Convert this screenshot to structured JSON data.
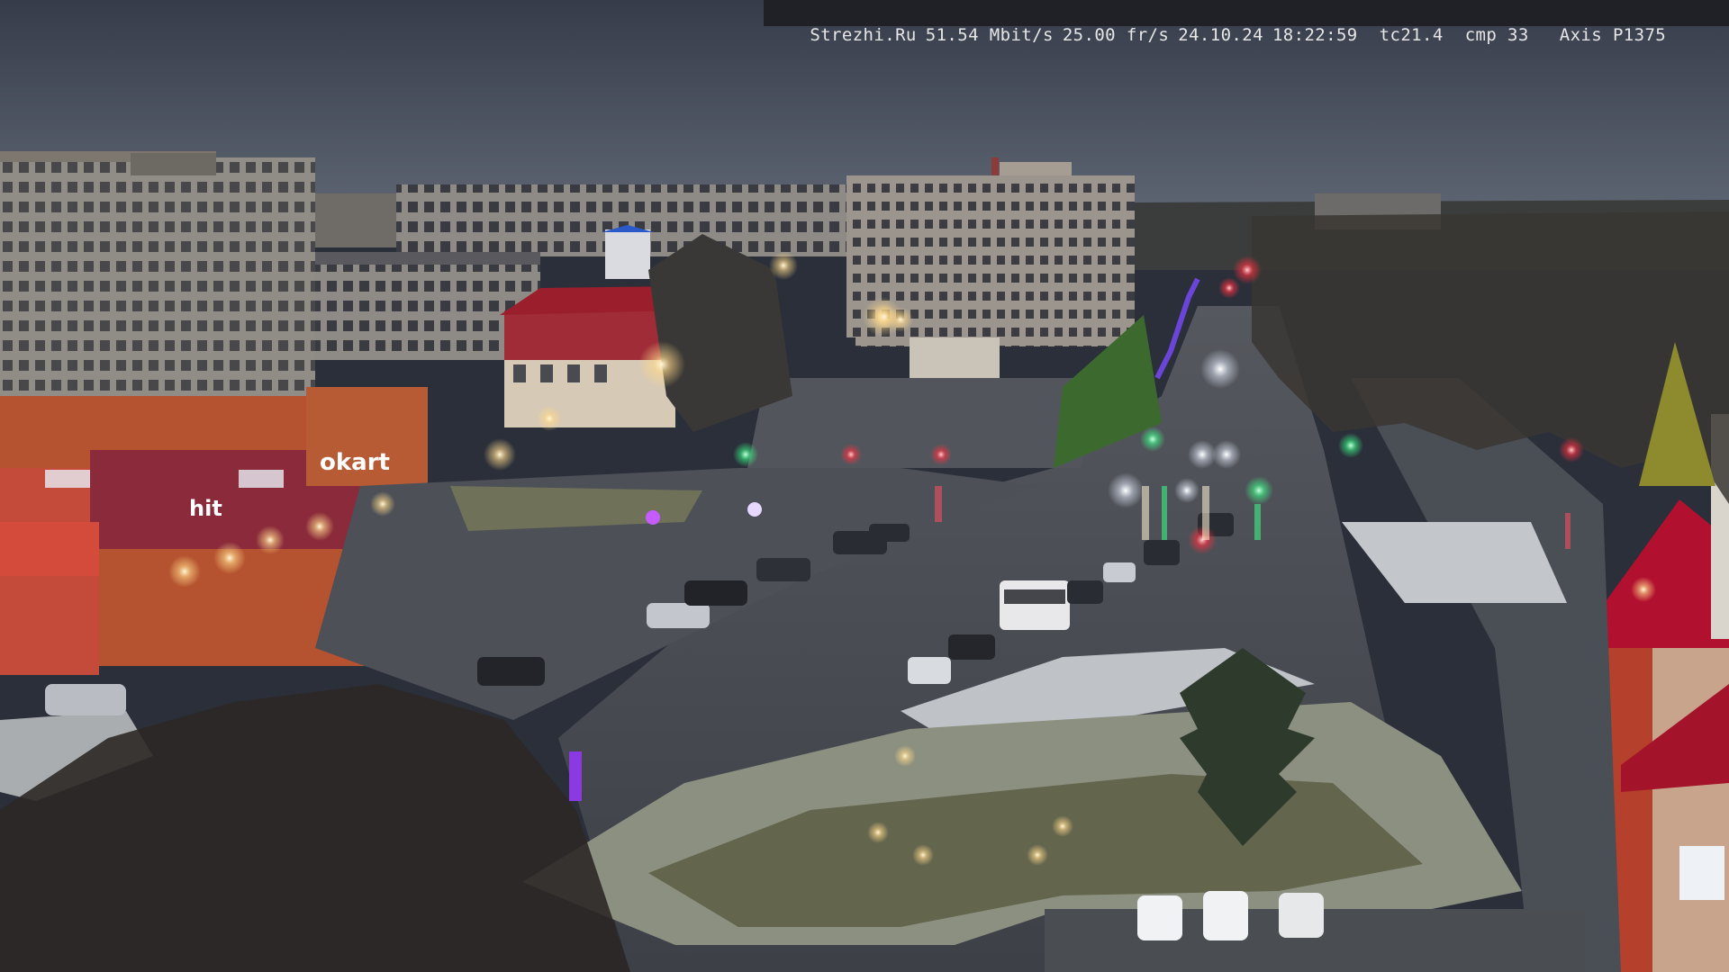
{
  "overlay": {
    "site": "Strezhi.Ru",
    "bitrate": "51.54 Mbit/s",
    "framerate": "25.00 fr/s",
    "date": "24.10.24",
    "time": "18:22:59",
    "tc": "tc21.4",
    "cmp": "cmp 33",
    "camera": "Axis P1375"
  },
  "signs": {
    "store_banner": "okart",
    "store_banner_2": "hit"
  },
  "colors": {
    "sky_top": "#3c4352",
    "sky_horizon": "#5a6170",
    "road": "#464a52",
    "snow": "#c9cdd2",
    "brick": "#b8512f",
    "roof_red": "#a3132a",
    "tree_dark": "#2a2a28",
    "light_warm": "#ffe6a8",
    "light_green": "#3dff8a",
    "light_red": "#ff3040"
  },
  "icons": {
    "street-lamp": "warm-lamp-glow",
    "traffic-light": "red-green-signal"
  }
}
